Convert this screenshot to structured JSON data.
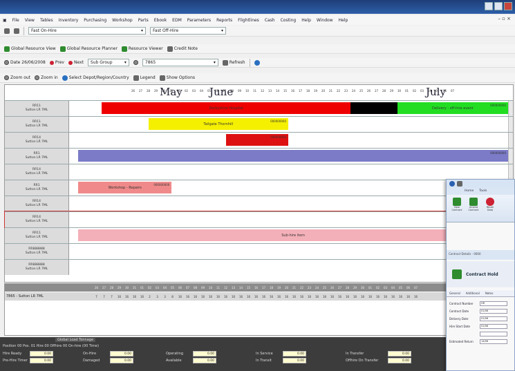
{
  "menu": [
    "File",
    "View",
    "Tables",
    "Inventory",
    "Purchasing",
    "Workshop",
    "Parts",
    "Ebook",
    "EDM",
    "Parameters",
    "Reports",
    "Flightlines",
    "Cash",
    "Costing",
    "Help",
    "Window",
    "Help"
  ],
  "toolbar1": {
    "combo1": "Fast On-Hire",
    "combo2": "Fast Off-Hire"
  },
  "toolbar2": {
    "b1": "Global Resource View",
    "b2": "Global Resource Planner",
    "b3": "Resource Viewer",
    "b4": "Credit Note"
  },
  "toolbar3": {
    "date": "Date 26/06/2008",
    "prev": "Prev",
    "next": "Next",
    "group": "Sub Group",
    "search": "7865",
    "refresh": "Refresh"
  },
  "toolbar4": {
    "zoom_out": "Zoom out",
    "zoom_in": "Zoom in",
    "select": "Select Depot/Region/Country",
    "legend": "Legend",
    "options": "Show Options"
  },
  "timeline": {
    "months": [
      "May",
      "June",
      "July"
    ],
    "days": [
      "26",
      "27",
      "28",
      "29",
      "30",
      "31",
      "01",
      "02",
      "03",
      "04",
      "05",
      "06",
      "07",
      "08",
      "09",
      "10",
      "11",
      "12",
      "13",
      "14",
      "15",
      "16",
      "17",
      "18",
      "19",
      "20",
      "21",
      "22",
      "23",
      "24",
      "25",
      "26",
      "27",
      "28",
      "29",
      "30",
      "01",
      "02",
      "03",
      "04",
      "05",
      "06",
      "07"
    ]
  },
  "rows": [
    {
      "id": "RR11",
      "desc": "Sutton LR 7ML"
    },
    {
      "id": "RR11",
      "desc": "Sutton LR 7ML"
    },
    {
      "id": "RR14",
      "desc": "Sutton LR 7ML"
    },
    {
      "id": "RR1",
      "desc": "Sutton LR 7ML"
    },
    {
      "id": "RR14",
      "desc": "Sutton LR 7ML"
    },
    {
      "id": "RR1",
      "desc": "Sutton LR 7ML"
    },
    {
      "id": "RR14",
      "desc": "Sutton LR 7ML"
    },
    {
      "id": "RR14",
      "desc": "Sutton LR 7ML"
    },
    {
      "id": "RR11",
      "desc": "Sutton LR 7ML"
    },
    {
      "id": "RR888888",
      "desc": "Sutton LR 7ML"
    },
    {
      "id": "RR888888",
      "desc": "Sutton LR 7ML"
    }
  ],
  "bars": [
    {
      "row": 0,
      "label": "Derbyshire Hospital",
      "tag": "",
      "color": "#ee0000",
      "start": 4,
      "end": 36
    },
    {
      "row": 0,
      "label": "",
      "tag": "",
      "color": "#000000",
      "start": 36,
      "end": 42
    },
    {
      "row": 0,
      "label": "Delivery - off-hire event",
      "tag": "000000000",
      "color": "#22dd22",
      "start": 42,
      "end": 57
    },
    {
      "row": 1,
      "label": "Tailgate Thornhill",
      "tag": "000000000",
      "color": "#f5f000",
      "start": 10,
      "end": 28
    },
    {
      "row": 2,
      "label": "",
      "tag": "000000000",
      "color": "#dd1111",
      "start": 20,
      "end": 28
    },
    {
      "row": 3,
      "label": "",
      "tag": "000000000",
      "color": "#7b7bc8",
      "start": 1,
      "end": 58
    },
    {
      "row": 5,
      "label": "Workshop - Repairs",
      "tag": "000000000",
      "color": "#f08a8a",
      "start": 1,
      "end": 13
    },
    {
      "row": 8,
      "label": "Sub-hire item",
      "tag": "",
      "color": "#f4b0b8",
      "start": 1,
      "end": 58
    }
  ],
  "capacity": {
    "label": "7865 - Sutton LR 7ML",
    "values": [
      "7",
      "7",
      "7",
      "16",
      "16",
      "16",
      "16",
      "2",
      "3",
      "3",
      "8",
      "16",
      "16",
      "16",
      "16",
      "16",
      "16",
      "16",
      "16",
      "16",
      "16",
      "16",
      "16",
      "16",
      "16",
      "16",
      "16",
      "16",
      "16",
      "16",
      "16",
      "16",
      "16",
      "16",
      "16",
      "16",
      "16",
      "16",
      "16",
      "16",
      "16",
      "16",
      "16"
    ]
  },
  "status": {
    "caption": "Global Load Tonnage",
    "line": "Position 00 Pos. 01 Hire 00 Offhire 00 On-hire (00 Time)",
    "fields": [
      {
        "label": "Hire Ready",
        "value": "0.00"
      },
      {
        "label": "Pre-Hire Timer",
        "value": "0.00"
      },
      {
        "label": "On-Hire",
        "value": "0.00"
      },
      {
        "label": "Damaged",
        "value": "0.00"
      },
      {
        "label": "Operating",
        "value": "0.00"
      },
      {
        "label": "Available",
        "value": "0.00"
      },
      {
        "label": "In Service",
        "value": "0.00"
      },
      {
        "label": "In Transit",
        "value": "0.00"
      },
      {
        "label": "In Transfer",
        "value": "0.00"
      },
      {
        "label": "Offhire On Transfer",
        "value": "0.00"
      }
    ]
  },
  "popup": {
    "tabs": [
      "Home",
      "Tools"
    ],
    "ribbon": [
      "New Contract",
      "Amend Contract",
      "Recall Data"
    ],
    "subwin": "Contract Details - 0000",
    "title": "Contract Hold",
    "tabs2": [
      "General",
      "Additional",
      "Notes"
    ],
    "fields": [
      {
        "label": "Contract Number",
        "value": "HR"
      },
      {
        "label": "Contract Date",
        "value": "01/06"
      },
      {
        "label": "Delivery Date",
        "value": "01/06"
      },
      {
        "label": "Hire Start Date",
        "value": "01/06"
      },
      {
        "label": "",
        "value": ""
      },
      {
        "label": "Estimated Return",
        "value": "14/06"
      }
    ]
  }
}
